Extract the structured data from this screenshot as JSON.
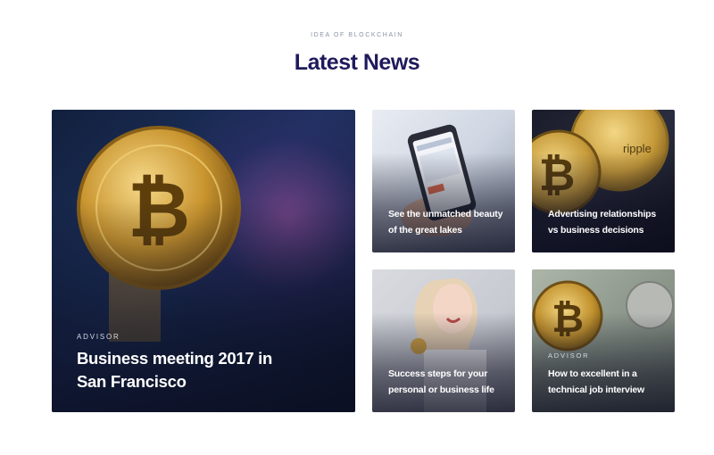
{
  "section": {
    "eyebrow": "IDEA OF BLOCKCHAIN",
    "title": "Latest News"
  },
  "cards": [
    {
      "category": "ADVISOR",
      "title": "Business meeting 2017 in San Francisco",
      "image": "bitcoin-coin-icon"
    },
    {
      "category": "",
      "title": "See the unmatched beauty of the great lakes",
      "image": "smartphone-icon"
    },
    {
      "category": "",
      "title": "Advertising relationships vs business decisions",
      "image": "ripple-coin-icon"
    },
    {
      "category": "",
      "title": "Success steps for your personal or business life",
      "image": "woman-portrait-icon"
    },
    {
      "category": "ADVISOR",
      "title": "How to excellent in a technical job interview",
      "image": "dollar-bills-icon"
    }
  ],
  "ripple_label": "ripple",
  "coin_symbol": "₿"
}
